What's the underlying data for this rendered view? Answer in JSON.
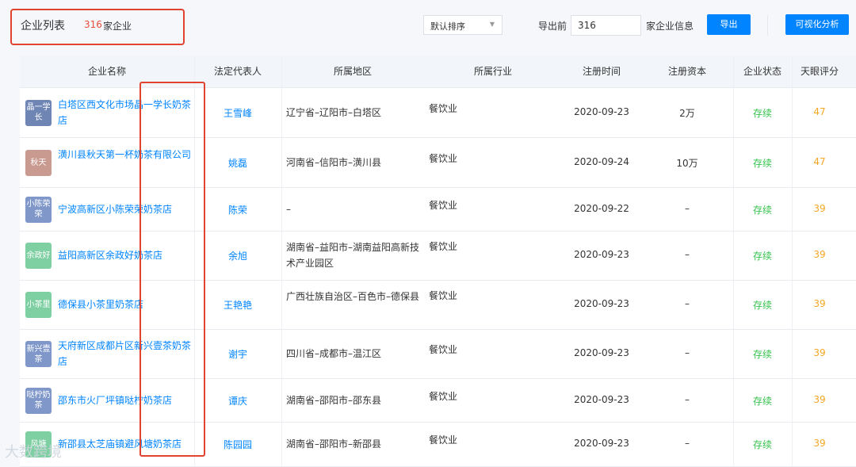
{
  "header": {
    "title": "企业列表",
    "count": "316",
    "count_suffix": "家企业",
    "sort_label": "默认排序",
    "export_prefix": "导出前",
    "export_value": "316",
    "export_suffix": "家企业信息",
    "export_button": "导出",
    "visual_button": "可视化分析"
  },
  "table": {
    "columns": [
      "企业名称",
      "法定代表人",
      "所属地区",
      "所属行业",
      "注册时间",
      "注册资本",
      "企业状态",
      "天眼评分"
    ],
    "rows": [
      {
        "logo_text": "晶一学长",
        "logo_color": "#6f86b5",
        "name": "白塔区西文化市场晶一学长奶茶店",
        "rep": "王雪峰",
        "region": "辽宁省–辽阳市–白塔区",
        "industry": "餐饮业",
        "date": "2020-09-23",
        "capital": "2万",
        "status": "存续",
        "score": "47"
      },
      {
        "logo_text": "秋天",
        "logo_color": "#c99a8f",
        "name": "潢川县秋天第一杯奶茶有限公司",
        "rep": "姚磊",
        "region": "河南省–信阳市–潢川县",
        "industry": "餐饮业",
        "date": "2020-09-24",
        "capital": "10万",
        "status": "存续",
        "score": "47"
      },
      {
        "logo_text": "小陈荣荣",
        "logo_color": "#7f97c9",
        "name": "宁波高新区小陈荣荣奶茶店",
        "rep": "陈荣",
        "region": "–",
        "industry": "餐饮业",
        "date": "2020-09-22",
        "capital": "–",
        "status": "存续",
        "score": "39"
      },
      {
        "logo_text": "余政好",
        "logo_color": "#7ecfa1",
        "name": "益阳高新区余政好奶茶店",
        "rep": "余旭",
        "region": "湖南省–益阳市–湖南益阳高新技术产业园区",
        "industry": "餐饮业",
        "date": "2020-09-23",
        "capital": "–",
        "status": "存续",
        "score": "39"
      },
      {
        "logo_text": "小茶里",
        "logo_color": "#7ecfa1",
        "name": "德保县小茶里奶茶店",
        "rep": "王艳艳",
        "region": "广西壮族自治区–百色市–德保县",
        "industry": "餐饮业",
        "date": "2020-09-23",
        "capital": "–",
        "status": "存续",
        "score": "39"
      },
      {
        "logo_text": "新兴壹茶",
        "logo_color": "#7f97c9",
        "name": "天府新区成都片区新兴壹茶奶茶店",
        "rep": "谢宇",
        "region": "四川省–成都市–温江区",
        "industry": "餐饮业",
        "date": "2020-09-23",
        "capital": "–",
        "status": "存续",
        "score": "39"
      },
      {
        "logo_text": "哒柠奶茶",
        "logo_color": "#7f97c9",
        "name": "邵东市火厂坪镇哒柠奶茶店",
        "rep": "谭庆",
        "region": "湖南省–邵阳市–邵东县",
        "industry": "餐饮业",
        "date": "2020-09-23",
        "capital": "–",
        "status": "存续",
        "score": "39"
      },
      {
        "logo_text": "风塘",
        "logo_color": "#7ecfa1",
        "name": "新邵县太芝庙镇避风塘奶茶店",
        "rep": "陈园园",
        "region": "湖南省–邵阳市–新邵县",
        "industry": "餐饮业",
        "date": "2020-09-23",
        "capital": "–",
        "status": "存续",
        "score": "39"
      }
    ]
  },
  "watermark": "大数跨境"
}
